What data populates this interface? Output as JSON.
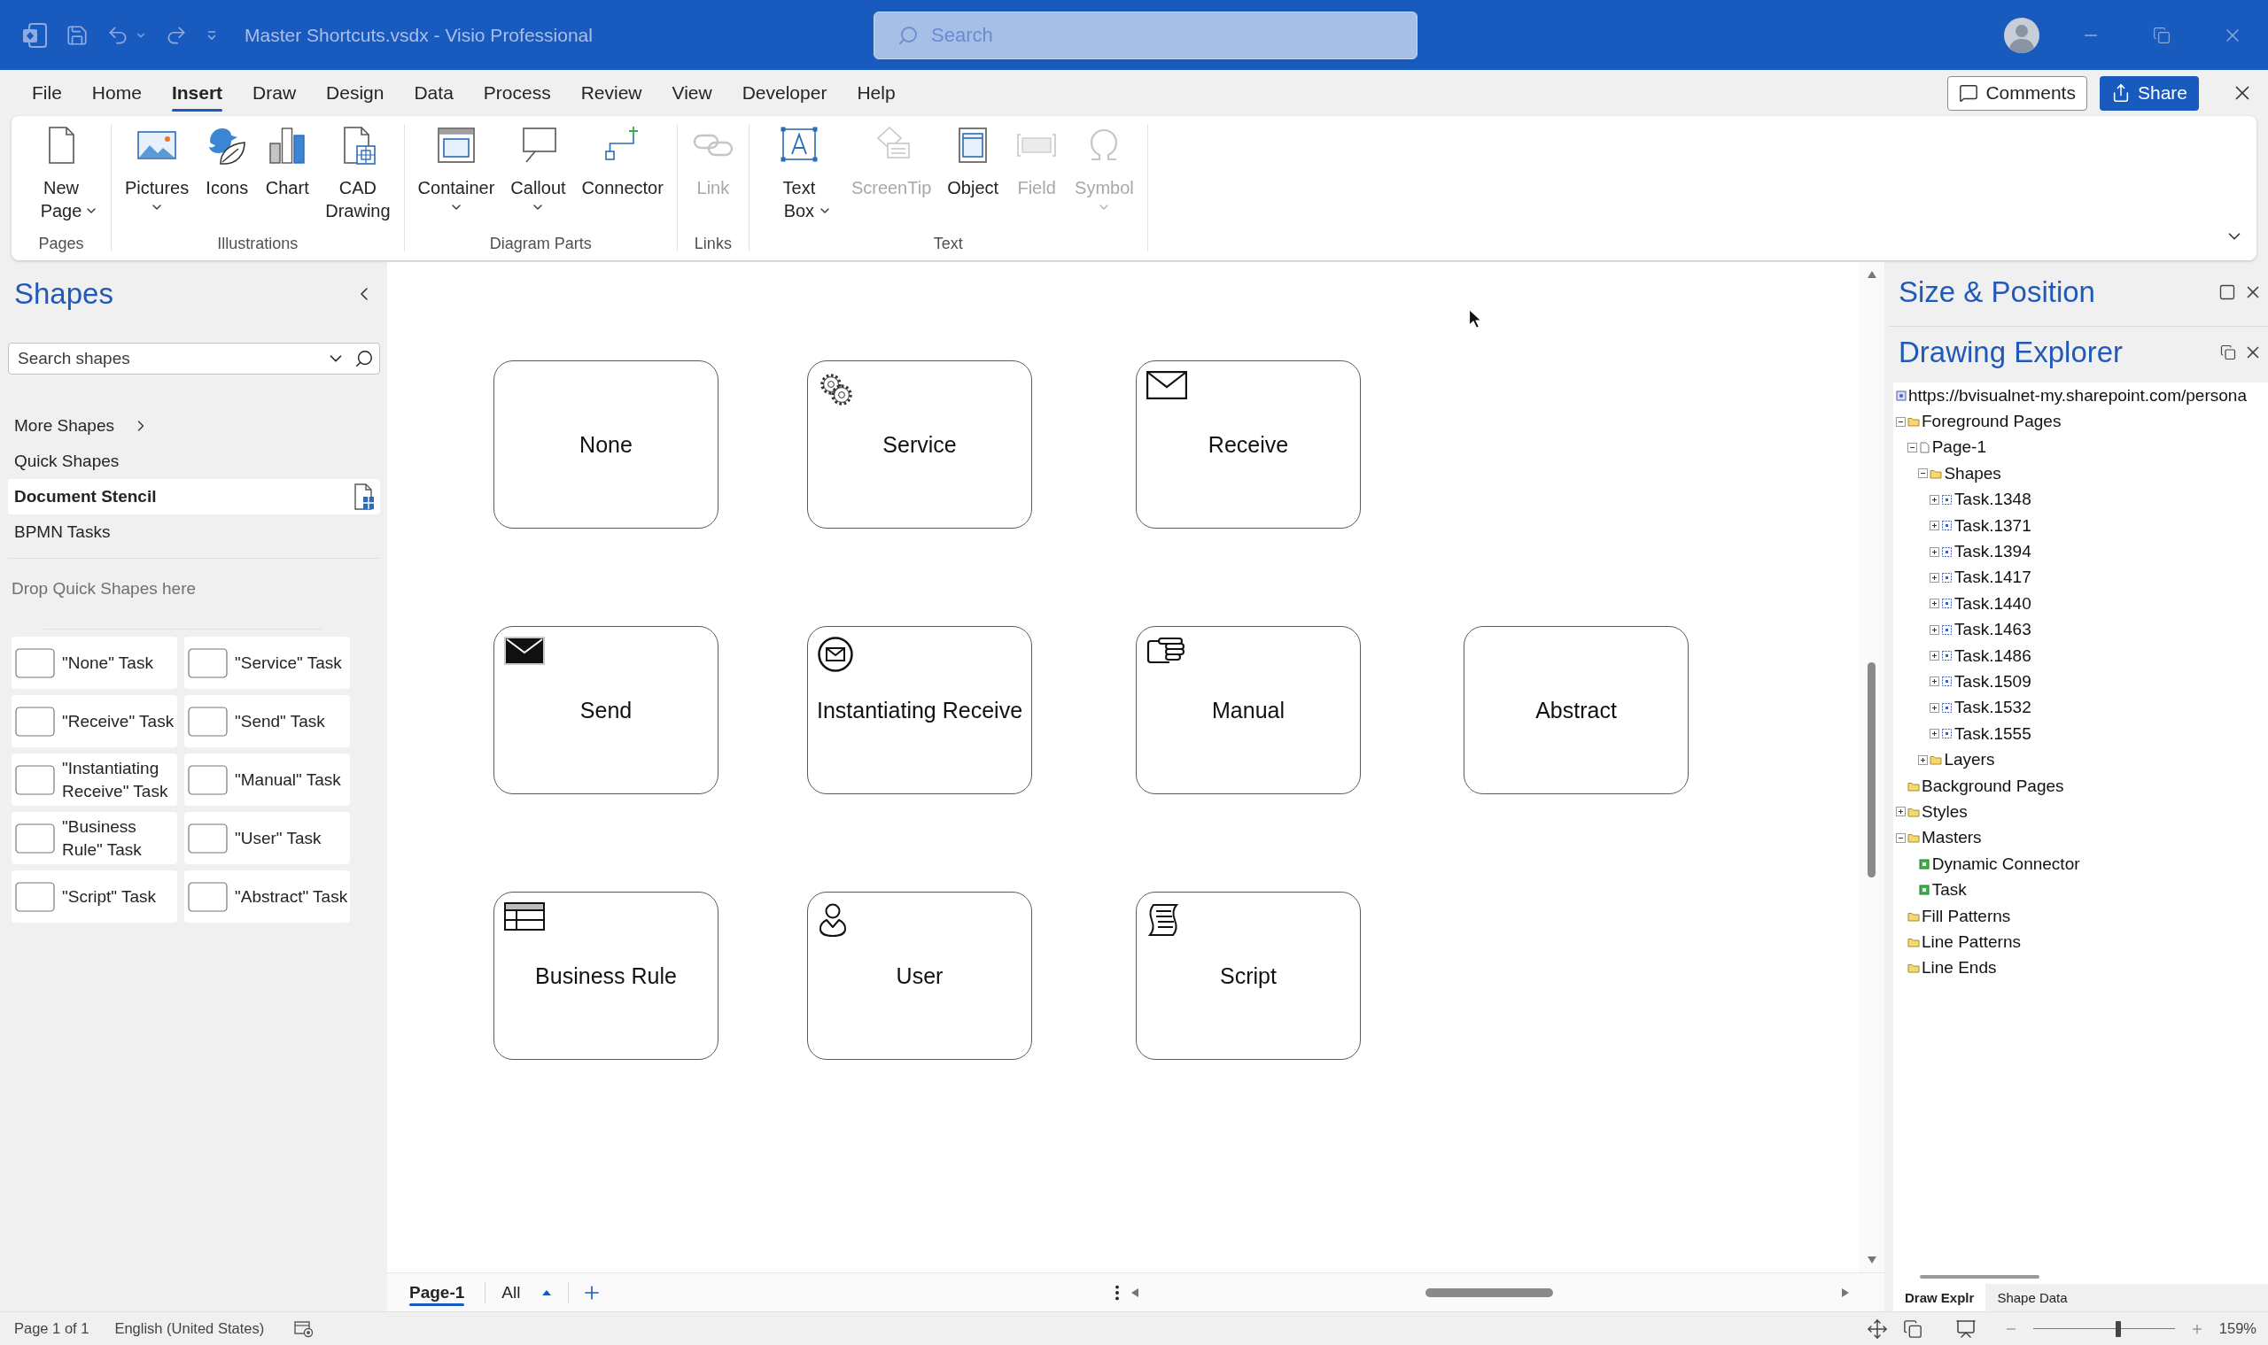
{
  "window": {
    "title": "Master Shortcuts.vsdx - Visio Professional",
    "search": {
      "placeholder": "Search"
    }
  },
  "tabs": [
    {
      "label": "File",
      "selected": false
    },
    {
      "label": "Home",
      "selected": false
    },
    {
      "label": "Insert",
      "selected": true
    },
    {
      "label": "Draw",
      "selected": false
    },
    {
      "label": "Design",
      "selected": false
    },
    {
      "label": "Data",
      "selected": false
    },
    {
      "label": "Process",
      "selected": false
    },
    {
      "label": "Review",
      "selected": false
    },
    {
      "label": "View",
      "selected": false
    },
    {
      "label": "Developer",
      "selected": false
    },
    {
      "label": "Help",
      "selected": false
    }
  ],
  "header_buttons": {
    "comments": "Comments",
    "share": "Share"
  },
  "ribbon": {
    "groups": [
      {
        "label": "Pages",
        "buttons": [
          {
            "label": "New Page",
            "kind": "twoline",
            "dropdown": true,
            "disabled": false
          }
        ]
      },
      {
        "label": "Illustrations",
        "buttons": [
          {
            "label": "Pictures",
            "kind": "oneline",
            "dropdown": true,
            "disabled": false
          },
          {
            "label": "Icons",
            "kind": "oneline",
            "dropdown": false,
            "disabled": false
          },
          {
            "label": "Chart",
            "kind": "oneline",
            "dropdown": false,
            "disabled": false
          },
          {
            "label": "CAD Drawing",
            "kind": "twoline",
            "dropdown": false,
            "disabled": false
          }
        ]
      },
      {
        "label": "Diagram Parts",
        "buttons": [
          {
            "label": "Container",
            "kind": "oneline",
            "dropdown": true,
            "disabled": false
          },
          {
            "label": "Callout",
            "kind": "oneline",
            "dropdown": true,
            "disabled": false
          },
          {
            "label": "Connector",
            "kind": "oneline",
            "dropdown": false,
            "disabled": false
          }
        ]
      },
      {
        "label": "Links",
        "buttons": [
          {
            "label": "Link",
            "kind": "oneline",
            "dropdown": false,
            "disabled": true
          }
        ]
      },
      {
        "label": "Text",
        "buttons": [
          {
            "label": "Text Box",
            "kind": "twoline",
            "dropdown": true,
            "disabled": false
          },
          {
            "label": "ScreenTip",
            "kind": "oneline",
            "dropdown": false,
            "disabled": true
          },
          {
            "label": "Object",
            "kind": "oneline",
            "dropdown": false,
            "disabled": false
          },
          {
            "label": "Field",
            "kind": "oneline",
            "dropdown": false,
            "disabled": true
          },
          {
            "label": "Symbol",
            "kind": "oneline",
            "dropdown": true,
            "disabled": true
          }
        ]
      }
    ]
  },
  "shapes_panel": {
    "title": "Shapes",
    "search": {
      "placeholder": "Search shapes"
    },
    "stencils": [
      {
        "label": "More Shapes",
        "kind": "submenu",
        "selected": false
      },
      {
        "label": "Quick Shapes",
        "kind": "stencil",
        "selected": false
      },
      {
        "label": "Document Stencil",
        "kind": "stencil",
        "selected": true
      },
      {
        "label": "BPMN Tasks",
        "kind": "stencil",
        "selected": false
      }
    ],
    "drop_hint": "Drop Quick Shapes here",
    "quick_shapes": [
      {
        "label": "\"None\" Task"
      },
      {
        "label": "\"Service\" Task"
      },
      {
        "label": "\"Receive\" Task"
      },
      {
        "label": "\"Send\" Task"
      },
      {
        "label": "\"Instantiating Receive\" Task"
      },
      {
        "label": "\"Manual\" Task"
      },
      {
        "label": "\"Business Rule\" Task"
      },
      {
        "label": "\"User\" Task"
      },
      {
        "label": "\"Script\" Task"
      },
      {
        "label": "\"Abstract\" Task"
      }
    ]
  },
  "canvas": {
    "rows": [
      [
        {
          "label": "None"
        },
        {
          "label": "Service"
        },
        {
          "label": "Receive"
        }
      ],
      [
        {
          "label": "Send"
        },
        {
          "label": "Instantiating Receive"
        },
        {
          "label": "Manual"
        },
        {
          "label": "Abstract"
        }
      ],
      [
        {
          "label": "Business Rule"
        },
        {
          "label": "User"
        },
        {
          "label": "Script"
        }
      ]
    ]
  },
  "page_bar": {
    "tabs": [
      {
        "label": "Page-1",
        "selected": true
      }
    ],
    "filter": "All"
  },
  "size_position": {
    "title": "Size & Position"
  },
  "drawing_explorer": {
    "title": "Drawing Explorer",
    "tree": {
      "label": "https://bvisualnet-my.sharepoint.com/persona",
      "kind": "document",
      "children": [
        {
          "label": "Foreground Pages",
          "kind": "folder",
          "expanded": true,
          "children": [
            {
              "label": "Page-1",
              "kind": "page",
              "expanded": true,
              "children": [
                {
                  "label": "Shapes",
                  "kind": "folder",
                  "expanded": true,
                  "children": [
                    {
                      "label": "Task.1348",
                      "kind": "shape",
                      "expanded": false
                    },
                    {
                      "label": "Task.1371",
                      "kind": "shape",
                      "expanded": false
                    },
                    {
                      "label": "Task.1394",
                      "kind": "shape",
                      "expanded": false
                    },
                    {
                      "label": "Task.1417",
                      "kind": "shape",
                      "expanded": false
                    },
                    {
                      "label": "Task.1440",
                      "kind": "shape",
                      "expanded": false
                    },
                    {
                      "label": "Task.1463",
                      "kind": "shape",
                      "expanded": false
                    },
                    {
                      "label": "Task.1486",
                      "kind": "shape",
                      "expanded": false
                    },
                    {
                      "label": "Task.1509",
                      "kind": "shape",
                      "expanded": false
                    },
                    {
                      "label": "Task.1532",
                      "kind": "shape",
                      "expanded": false
                    },
                    {
                      "label": "Task.1555",
                      "kind": "shape",
                      "expanded": false
                    }
                  ]
                },
                {
                  "label": "Layers",
                  "kind": "folder",
                  "expanded": false
                }
              ]
            }
          ]
        },
        {
          "label": "Background Pages",
          "kind": "folder"
        },
        {
          "label": "Styles",
          "kind": "folder",
          "expanded": false
        },
        {
          "label": "Masters",
          "kind": "folder",
          "expanded": true,
          "children": [
            {
              "label": "Dynamic Connector",
              "kind": "master"
            },
            {
              "label": "Task",
              "kind": "master"
            }
          ]
        },
        {
          "label": "Fill Patterns",
          "kind": "folder"
        },
        {
          "label": "Line Patterns",
          "kind": "folder"
        },
        {
          "label": "Line Ends",
          "kind": "folder"
        }
      ]
    },
    "tabs": [
      {
        "label": "Draw Explr",
        "selected": true
      },
      {
        "label": "Shape Data",
        "selected": false
      }
    ]
  },
  "status_bar": {
    "page": "Page 1 of 1",
    "language": "English (United States)",
    "zoom": {
      "level": 0.6,
      "reading": "159%"
    }
  }
}
